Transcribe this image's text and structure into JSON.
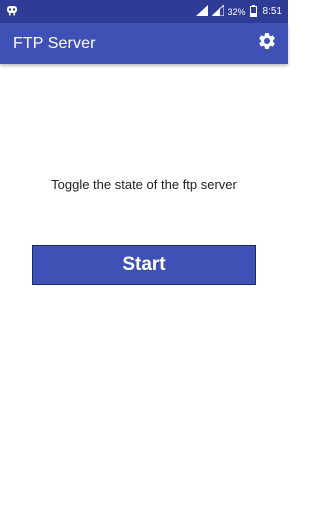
{
  "status_bar": {
    "battery_percent": "32%",
    "time": "8:51",
    "icons": [
      "app-notification-icon",
      "signal-icon",
      "signal-icon",
      "battery-icon"
    ]
  },
  "app_bar": {
    "title": "FTP Server",
    "settings_icon": "gear-icon"
  },
  "main": {
    "instruction": "Toggle the state of the ftp server",
    "start_button_label": "Start"
  },
  "colors": {
    "status_bar": "#2f3c96",
    "app_bar": "#3f51b5",
    "button": "#3f51b5",
    "background": "#ffffff"
  }
}
